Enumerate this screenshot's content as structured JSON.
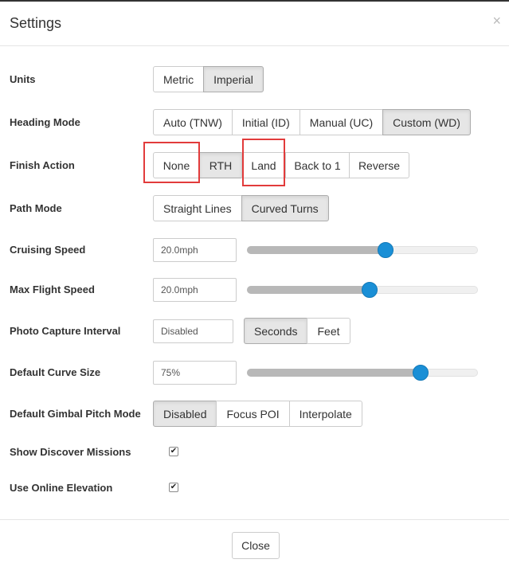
{
  "dialog": {
    "title": "Settings",
    "close_glyph": "×",
    "close_icon": "close-icon"
  },
  "units": {
    "label": "Units",
    "options": [
      "Metric",
      "Imperial"
    ],
    "selected": "Imperial"
  },
  "heading_mode": {
    "label": "Heading Mode",
    "options": [
      "Auto (TNW)",
      "Initial (ID)",
      "Manual (UC)",
      "Custom (WD)"
    ],
    "selected": "Custom (WD)"
  },
  "finish_action": {
    "label": "Finish Action",
    "options": [
      "None",
      "RTH",
      "Land",
      "Back to 1",
      "Reverse"
    ],
    "selected": "RTH"
  },
  "path_mode": {
    "label": "Path Mode",
    "options": [
      "Straight Lines",
      "Curved Turns"
    ],
    "selected": "Curved Turns"
  },
  "cruising_speed": {
    "label": "Cruising Speed",
    "value": "20.0mph",
    "slider_fraction": 0.6
  },
  "max_flight_speed": {
    "label": "Max Flight Speed",
    "value": "20.0mph",
    "slider_fraction": 0.53
  },
  "photo_capture_interval": {
    "label": "Photo Capture Interval",
    "value": "Disabled",
    "options": [
      "Seconds",
      "Feet"
    ],
    "selected": "Seconds"
  },
  "default_curve_size": {
    "label": "Default Curve Size",
    "value": "75%",
    "slider_fraction": 0.75
  },
  "gimbal_pitch_mode": {
    "label": "Default Gimbal Pitch Mode",
    "options": [
      "Disabled",
      "Focus POI",
      "Interpolate"
    ],
    "selected": "Disabled"
  },
  "show_discover_missions": {
    "label": "Show Discover Missions",
    "checked": true,
    "check_glyph": "✔"
  },
  "use_online_elevation": {
    "label": "Use Online Elevation",
    "checked": true,
    "check_glyph": "✔"
  },
  "footer": {
    "close_label": "Close"
  },
  "colors": {
    "accent": "#1a8fd6",
    "highlight": "#e23b3b",
    "active_button": "#e6e6e6"
  }
}
